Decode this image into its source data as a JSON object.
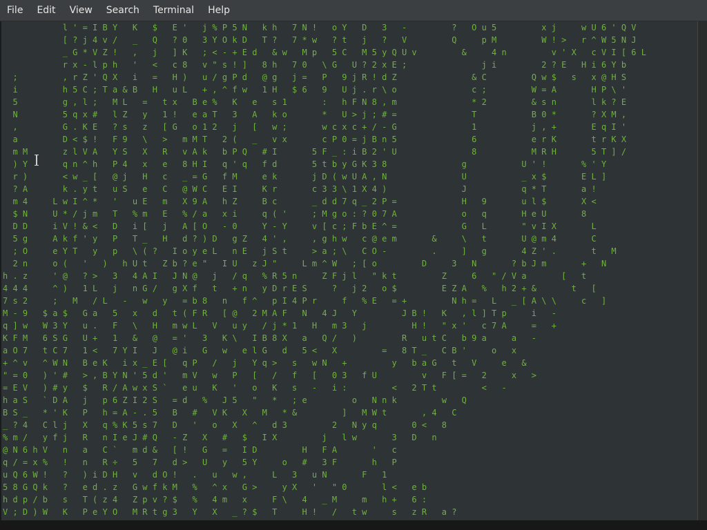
{
  "menubar": {
    "items": [
      "File",
      "Edit",
      "View",
      "Search",
      "Terminal",
      "Help"
    ]
  },
  "terminal": {
    "text_color": "#6fb33a",
    "bright_color": "#e6e6e6",
    "background": "#2e3436",
    "content": "            l ' = I B Y   K   $   E '   j % P 5 N   k h   7 N !   o Y   D   3   -         ?   O u 5         x j     w U 6 ' Q V\n            [ ? j 4 v /   _   Q   ? 0   3 Y O k D   T ?   7 * w   ? t   j   ?   V         Q     p M         W ! >   r ^ W 5 N J\n            _ G * V Z !   ,   j   ] K   ; < - + E d   & w   M p   5 C   M 5 y Q U v         &     4 n         v ' X   c V I [ 6 L\n            r x - l p h   '   <   c 8   v \" s ! ]   8 h   7 0   \\ G   U ? 2 x E ;               j i         2 ? E   H i 6 Y b\n  ;         , r Z ' Q X   i   =   H )   u / g P d   @ g   j =   P   9 j R ! d Z               & C         Q w $   s   x @ H S\n  i         h 5 C ; T a & B   H   u L   + , ^ f w   1 H   $ 6   9   U j . r \\ o               c ;         W = A       H P \\ '\n  5         g , l ;   M L   =   t x   B e %   K   e   s 1       :   h F N 8 , m               * 2         & s n       l k ? E\n  N         5 q x #   l Z   y   1 !   e a T   3   A   k o       *   U > j ; # =               T           B 0 *       ? X M ,\n  ,         G . K E   ? s   z   [ G   o 1 2   j   [   w ;       w c x c + / - G               1           j , +       E q I '\n  a         D < $ !   F 9   \\   >   m M T   2 (   _   v x       c P 0 = j B n 5               6           e r K       t r K X\n  m M       z l V A   Y S   X   R   v A k   b P Q   # I       5 F _ : i B 2 ' U               8           M R H       5 T ] /\n  ) Y       q n ^ h   P 4   x   e   8 H I   q ' q   f d       5 t b y G K 3 8               g           U ' !       % ' Y\n  r )       < w _ [   @ j   H   c   _ = G   f M     e k       j D ( w U A , N               U           _ x $       E L ]\n  ? A       k . y t   u S   e   C   @ W C   E I     K r       c 3 3 \\ 1 X 4 )               J           q * T       a !\n  m 4     L w I ^ *   '   u E   m   X 9 A   h Z     B c       _ d d 7 q _ 2 P =             H   9       u l $       X <\n  $ N     U * / j m   T   % m   E   % / a   x i     q ( '     ; M g o : ? 0 7 A             o   q       H e U       8\n  D D     i V ! & <   D   i [   j   A [ O   - 0     Y - Y     v [ c ; F b E ^ =             G   L       \" v I X       L\n  5 g     A k f ' y   P   T _   H   d ? ) D   g Z   4 ' ,     , g h w   c @ e m       &     \\   t       U @ m 4       C\n  ; O     e Y T   y   p   \\ ( ?   I o y e L   n E   j S t     > a ; \\   C O -         .     ]   g       4 Z ' .       t   M\n  2 n     o (   '   )   h U t   Z b ? e \"   I U   z J \"     L m ^ W   ; [ o         D     3   N       ? b J m       +   N\nh . z     ' @   ? >   3   4 A I   J N @   j   / q   % R 5 n     Z F j l   \" k t         Z     6   \" / V a       [   t\n4 4 4     ^ )   1 L   j   n G /   g X f   t   + n   y D r E S     ?   j 2   o $         E Z A   %   h 2 + &       t   [\n7 s 2     ;   M   / L   -   w   y   = b 8   n   f ^   p I 4 P r     f   % E   = +         N h =   L   _ [ A \\ \\     c   ]\nM - 9   $ a $   G a   5   x   d   t ( F R   [ @   2 M A F   N   4 J   Y         J B !   K   , l ] T p     i   -\nq ] w   W 3 Y   u .   F   \\   H   m w L   V   u y   / j * 1   H   m 3   j         H !   \" x '   c 7 A     =   +\nK F M   6 S G   U +   1   &   @   = '   3   K \\   I B 8 X   a   Q /   )         R   u t C   b 9 a     a   -\na O 7   t C 7   1 <   7 Y I   J   @ i   G   w   e l G   d   5 <   X         =   8 T _   C B '     o   x\n+ ^ v   ^ W N   B e K   i x _ E [   q P   /   j   Y q >   s   w N   +         y   b a G   t   V     e   &\n\" = 0   ) ' #   > , B Y N ' 5 d '   m V   w   P   [   /   f   [   0 3   f U         v   F [ =   2     x   >\n= E V   ) # y   $   R / A w x S `   e u   K   '   o   K   s   -   i :         <   2 T t         <   -\nh a S   ` D A   j   p 6 Z I 2 S   = d   %   J 5   \"   *   ; e         o   N n k         w   Q\nB S _   * ' K   P   h = A - . 5   B   #   V K   X   M   * &         ]   M W t       , 4   C\n_ ? 4   C l j   X   q % K 5 s 7   D   '   o   X   ^   d 3         2   N y q       0 <   8\n% m /   y f j   R   n I e J # Q   - Z   X   #   $   I X         j   l w       3   D   n\n@ N 6 h V   n   a   C `   m d &   [ !   G   =   I D         H   F A       '   c\nq / = x %   !   n   R ÷   5   7   d >   U   y   5 Y     o   #   3 F       h   P\nu Q 6 W !   ?   ) i D H   v   d O !   .   u   w ,     L   3   u N       F   1\n5 8 G Q k   ?   e d . z   G w f k M   %   ^ x   G >     y X   '   \" 0       l <   e b\nh d p / b   s   T ( z 4   Z p v ? $   %   4 m   x     F \\   4   _ M     m   h +   6 :\nV ; D ) W   K   P e Y O   M R t g 3   Y   X   _ ? $   T     H !   /   t w     s   z R   a ?"
  },
  "colors": {
    "menubar_bg": "#3c3f41",
    "terminal_bg": "#2e3436",
    "text_green": "#6fb33a"
  }
}
